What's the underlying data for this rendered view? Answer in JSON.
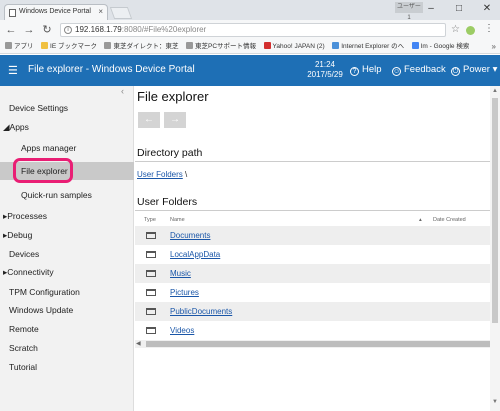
{
  "browser": {
    "tab_title": "Windows Device Portal",
    "tab_close": "×",
    "user_badge": "ユーザー 1",
    "window_controls": [
      "–",
      "□",
      "✕"
    ],
    "url_host": "192.168.1.79",
    "url_rest": ":8080/#File%20explorer",
    "bookmarks": [
      "アプリ",
      "IE ブックマーク",
      "東芝ダイレクト：東芝",
      "東芝PCサポート情報",
      "Yahoo! JAPAN (2)",
      "Internet Explorer のへ",
      "Im - Google 検索"
    ],
    "bookmarks_more": "»"
  },
  "header": {
    "title": "File explorer - Windows Device Portal",
    "time": "21:24",
    "date": "2017/5/29",
    "help": "Help",
    "feedback": "Feedback",
    "power": "Power ▾"
  },
  "sidebar": {
    "collapse": "‹",
    "items": [
      {
        "label": "Device Settings"
      },
      {
        "label": "◢Apps"
      },
      {
        "label": "Apps manager"
      },
      {
        "label": "File explorer"
      },
      {
        "label": "Quick-run samples"
      },
      {
        "label": "▸Processes"
      },
      {
        "label": "▸Debug"
      },
      {
        "label": "Devices"
      },
      {
        "label": "▸Connectivity"
      },
      {
        "label": "TPM Configuration"
      },
      {
        "label": "Windows Update"
      },
      {
        "label": "Remote"
      },
      {
        "label": "Scratch"
      },
      {
        "label": "Tutorial"
      }
    ]
  },
  "main": {
    "title": "File explorer",
    "back": "←",
    "forward": "→",
    "directory_heading": "Directory path",
    "breadcrumb_link": "User Folders",
    "breadcrumb_sep": "\\",
    "folders_heading": "User Folders",
    "columns": [
      "Type",
      "Name",
      "Date Created"
    ],
    "sort_indicator": "▴",
    "folders": [
      "Documents",
      "LocalAppData",
      "Music",
      "Pictures",
      "PublicDocuments",
      "Videos"
    ]
  },
  "colors": {
    "header_bg": "#1e6fb5",
    "highlight": "#e91e74",
    "link": "#1a56a8"
  }
}
